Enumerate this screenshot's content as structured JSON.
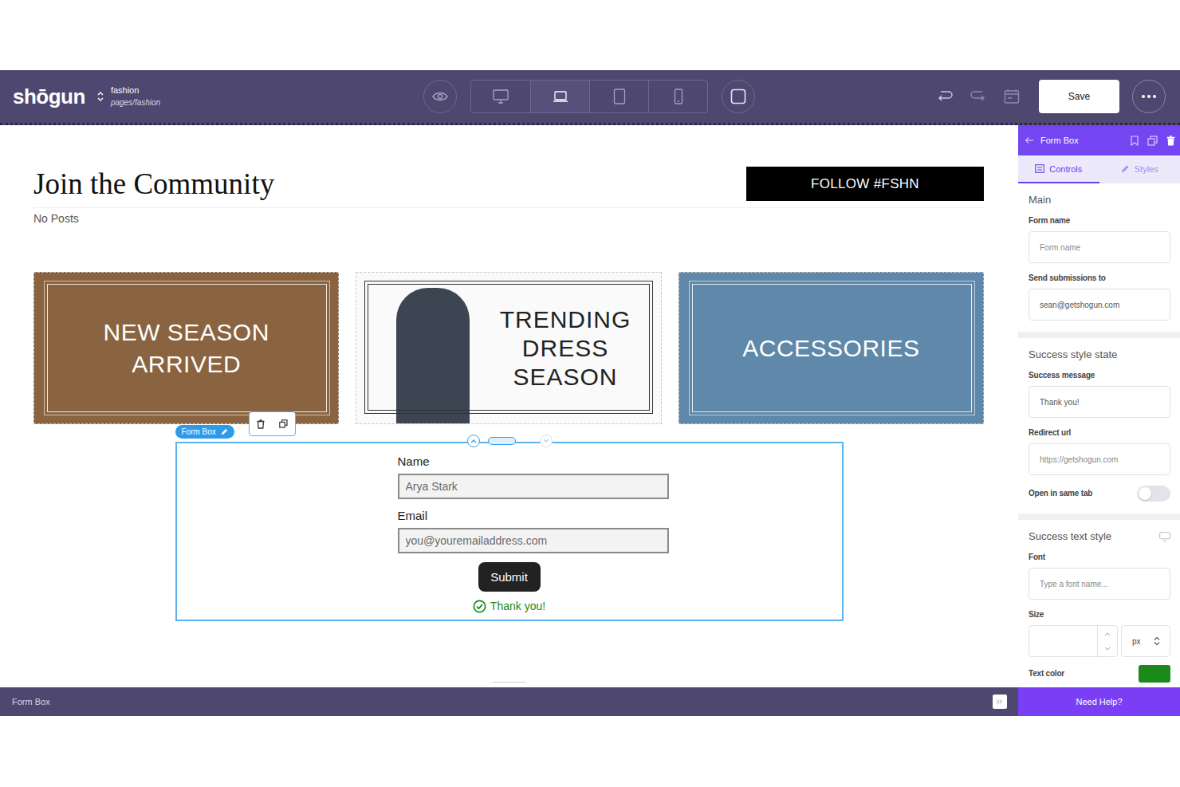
{
  "topbar": {
    "logo": "shōgun",
    "site": "fashion",
    "page": "pages/fashion",
    "devices": [
      {
        "kind": "desktop",
        "selected": false
      },
      {
        "kind": "laptop",
        "selected": true
      },
      {
        "kind": "tablet",
        "selected": false
      },
      {
        "kind": "mobile",
        "selected": false
      }
    ],
    "save": "Save"
  },
  "canvas": {
    "heading": "Join the Community",
    "empty_note": "No Posts",
    "follow_button": "FOLLOW #FSHN",
    "banners": [
      {
        "title": "NEW SEASON ARRIVED",
        "kind": "overlay"
      },
      {
        "title": "TRENDING DRESS SEASON",
        "kind": "split"
      },
      {
        "title": "ACCESSORIES",
        "kind": "overlay"
      }
    ],
    "form_box": {
      "tag": "Form Box",
      "fields": [
        {
          "label": "Name",
          "placeholder": "Arya Stark"
        },
        {
          "label": "Email",
          "placeholder": "you@youremailaddress.com"
        }
      ],
      "submit": "Submit",
      "success": "Thank you!"
    }
  },
  "panel": {
    "title": "Form Box",
    "tabs": [
      {
        "label": "Controls",
        "selected": true
      },
      {
        "label": "Styles",
        "selected": false
      }
    ],
    "sections": [
      {
        "title": "Main",
        "fields": [
          {
            "kind": "input",
            "label": "Form name",
            "placeholder": "Form name"
          },
          {
            "kind": "input",
            "label": "Send submissions to",
            "value": "sean@getshogun.com"
          }
        ]
      },
      {
        "title": "Success style state",
        "fields": [
          {
            "kind": "input",
            "label": "Success message",
            "value": "Thank you!"
          },
          {
            "kind": "input",
            "label": "Redirect url",
            "placeholder": "https://getshogun.com"
          },
          {
            "kind": "toggle",
            "label": "Open in same tab",
            "on": false
          }
        ]
      },
      {
        "title": "Success text style",
        "fields": [
          {
            "kind": "input",
            "label": "Font",
            "placeholder": "Type a font name..."
          },
          {
            "kind": "size",
            "label": "Size",
            "value": "",
            "unit": "px"
          },
          {
            "kind": "color",
            "label": "Text color",
            "color": "#1a8a1a"
          }
        ]
      }
    ]
  },
  "status_bar": {
    "selection": "Form Box",
    "help": "Need Help?"
  }
}
